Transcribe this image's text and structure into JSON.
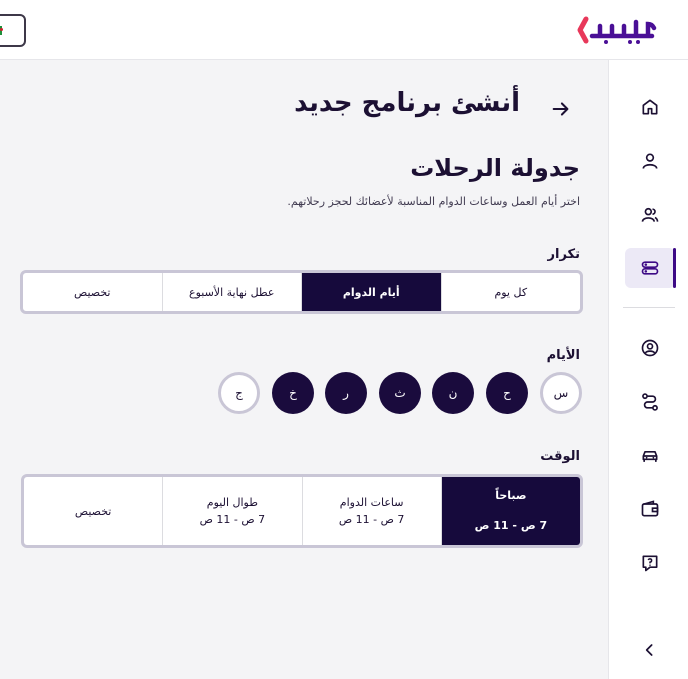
{
  "brand": {
    "logo_text": "يسير",
    "accent": "#3d0a85",
    "logo_color": "#4a0f96",
    "logo_chevron_color": "#e8385a"
  },
  "header": {
    "language_flag": "Algeria flag"
  },
  "sidebar": {
    "items": [
      {
        "icon": "home-icon"
      },
      {
        "icon": "user-icon"
      },
      {
        "icon": "users-icon"
      },
      {
        "icon": "schedule-icon",
        "active": true
      },
      {
        "icon": "account-circle-icon"
      },
      {
        "icon": "route-icon"
      },
      {
        "icon": "car-icon"
      },
      {
        "icon": "wallet-icon"
      },
      {
        "icon": "help-icon"
      }
    ],
    "collapse_icon": "chevron-left-icon"
  },
  "page": {
    "title": "أنشئ برنامج جديد",
    "section_title": "جدولة الرحلات",
    "section_subtitle": "اختر أيام العمل وساعات الدوام المناسبة لأعضائك لحجز رحلاتهم."
  },
  "repeat": {
    "label": "تكرار",
    "options": [
      {
        "label": "كل يوم",
        "active": false
      },
      {
        "label": "أيام الدوام",
        "active": true
      },
      {
        "label": "عطل نهاية الأسبوع",
        "active": false
      },
      {
        "label": "تخصيص",
        "active": false
      }
    ]
  },
  "days": {
    "label": "الأيام",
    "items": [
      {
        "label": "س",
        "selected": false
      },
      {
        "label": "ح",
        "selected": true
      },
      {
        "label": "ن",
        "selected": true
      },
      {
        "label": "ث",
        "selected": true
      },
      {
        "label": "ر",
        "selected": true
      },
      {
        "label": "خ",
        "selected": true
      },
      {
        "label": "ج",
        "selected": false
      }
    ]
  },
  "time": {
    "label": "الوقت",
    "options": [
      {
        "title": "صباحاً",
        "range": "7 ص - 11 ص",
        "active": true
      },
      {
        "title": "ساعات الدوام",
        "range": "7 ص - 11 ص",
        "active": false
      },
      {
        "title": "طوال اليوم",
        "range": "7 ص - 11 ص",
        "active": false
      },
      {
        "title": "تخصيص",
        "range": "",
        "active": false
      }
    ]
  }
}
